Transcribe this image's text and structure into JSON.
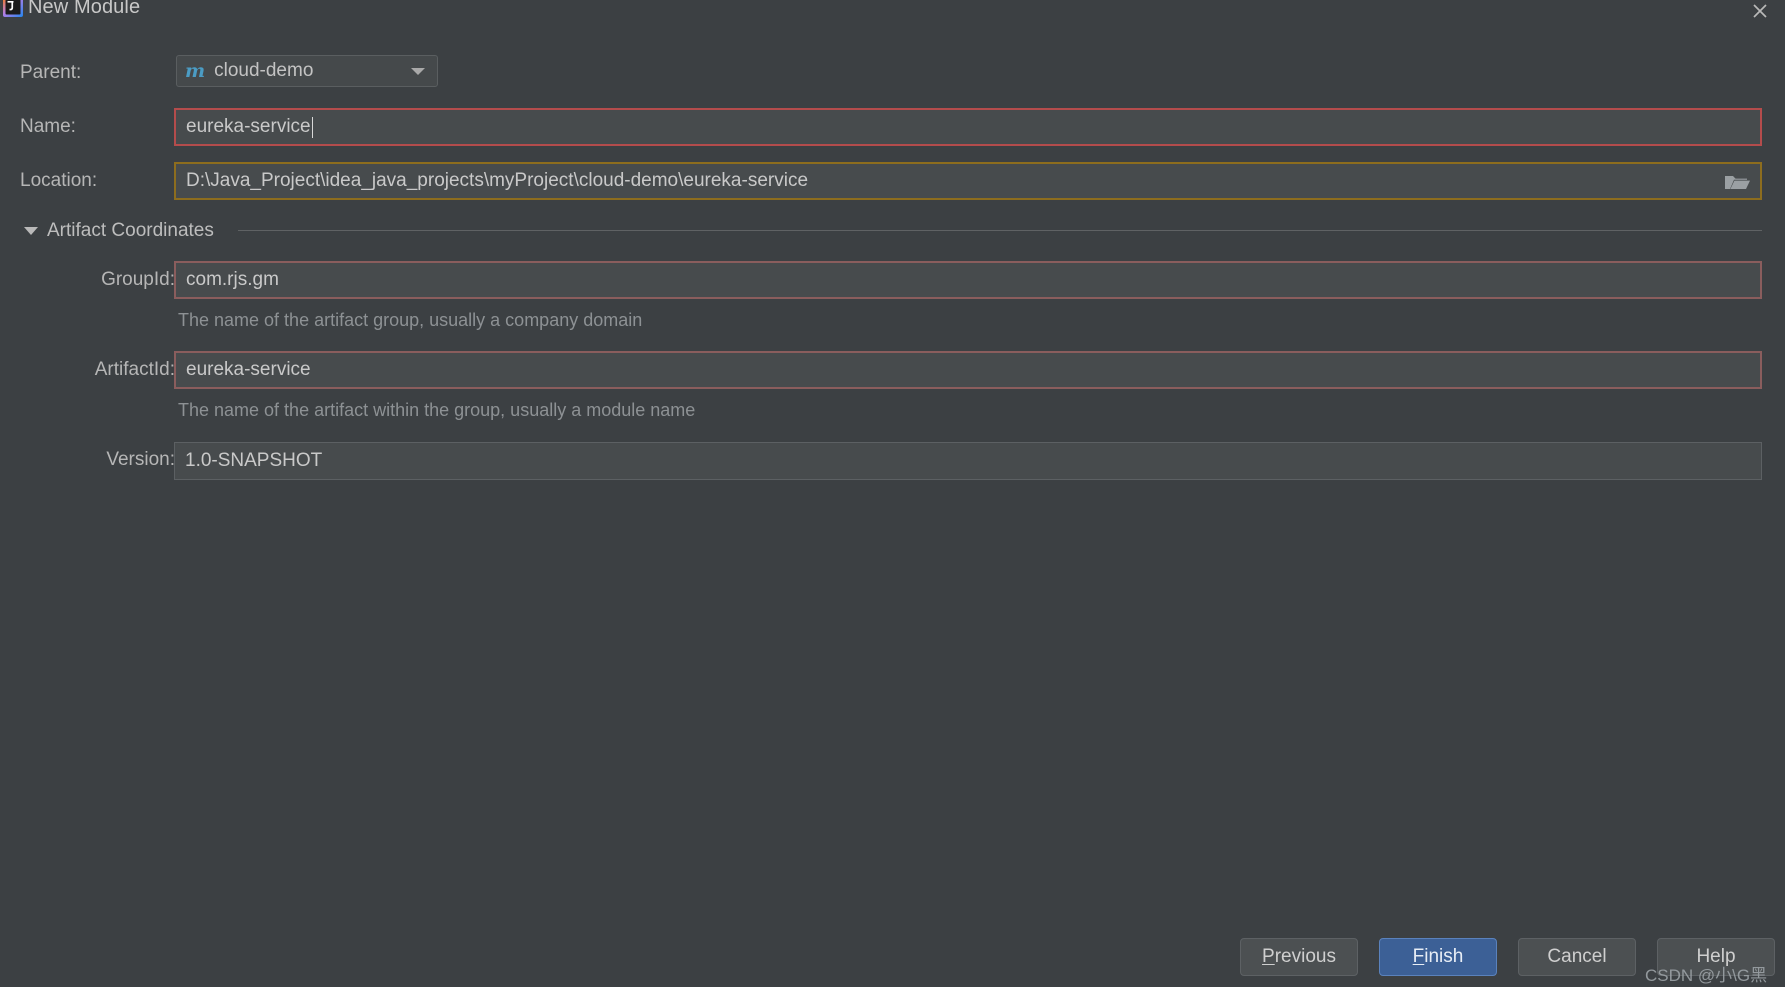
{
  "window": {
    "title": "New Module",
    "app_icon": "intellij-idea-icon",
    "close_icon": "close-icon"
  },
  "form": {
    "parent": {
      "label": "Parent:",
      "value": "cloud-demo",
      "icon": "maven-module-icon",
      "dropdown_icon": "chevron-down-icon"
    },
    "name": {
      "label": "Name:",
      "value": "eureka-service",
      "border_color": "#b44c4c"
    },
    "location": {
      "label": "Location:",
      "value": "D:\\Java_Project\\idea_java_projects\\myProject\\cloud-demo\\eureka-service",
      "browse_icon": "folder-icon",
      "border_color": "#8d6d1e"
    }
  },
  "artifact_section": {
    "title": "Artifact Coordinates",
    "collapse_icon": "triangle-down-icon",
    "group_id": {
      "label": "GroupId:",
      "value": "com.rjs.gm",
      "hint": "The name of the artifact group, usually a company domain",
      "border_color": "#8a5d5d"
    },
    "artifact_id": {
      "label": "ArtifactId:",
      "value": "eureka-service",
      "hint": "The name of the artifact within the group, usually a module name",
      "border_color": "#8a5d5d"
    },
    "version": {
      "label": "Version:",
      "value": "1.0-SNAPSHOT",
      "border_color": "#5c6063"
    }
  },
  "buttons": {
    "previous": {
      "mnemonic": "P",
      "rest": "revious"
    },
    "finish": {
      "mnemonic": "F",
      "rest": "inish"
    },
    "cancel": {
      "label": "Cancel"
    },
    "help": {
      "label": "Help"
    }
  },
  "watermark": {
    "text": "CSDN @小\\G黑"
  },
  "theme": {
    "background": "#3c4043",
    "field_background": "#474b4d",
    "text": "#c9c9c9",
    "accent": "#3c6096"
  }
}
